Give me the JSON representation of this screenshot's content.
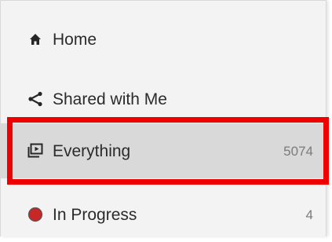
{
  "sidebar": {
    "items": [
      {
        "label": "Home",
        "icon": "home-icon",
        "count": ""
      },
      {
        "label": "Shared with Me",
        "icon": "share-icon",
        "count": ""
      },
      {
        "label": "Everything",
        "icon": "media-library-icon",
        "count": "5074",
        "selected": true
      },
      {
        "label": "In Progress",
        "icon": "red-circle-icon",
        "count": "4"
      }
    ]
  },
  "colors": {
    "highlight": "#ee0000",
    "selected_bg": "#d9d9d9",
    "in_progress_dot": "#c62828"
  }
}
